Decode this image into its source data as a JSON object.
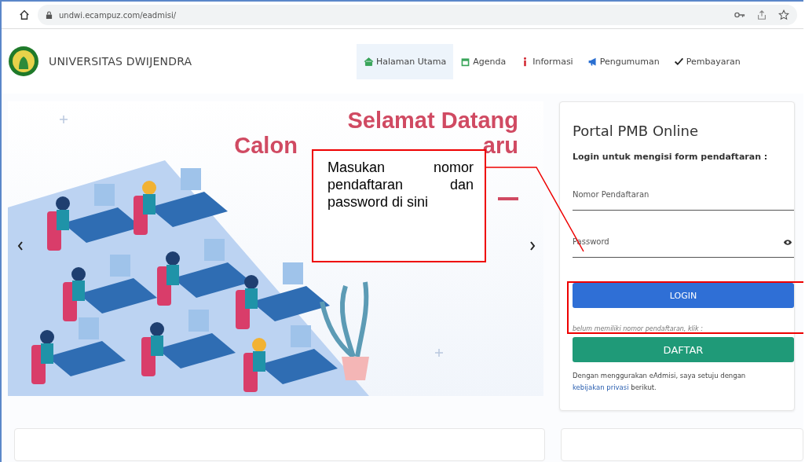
{
  "browser": {
    "url": "undwi.ecampuz.com/eadmisi/"
  },
  "header": {
    "brand": "UNIVERSITAS DWIJENDRA",
    "nav": [
      {
        "label": "Halaman Utama",
        "selected": true
      },
      {
        "label": "Agenda",
        "selected": false
      },
      {
        "label": "Informasi",
        "selected": false
      },
      {
        "label": "Pengumuman",
        "selected": false
      },
      {
        "label": "Pembayaran",
        "selected": false
      }
    ]
  },
  "hero": {
    "title_line1": "Selamat Datang",
    "title_line2_parts": [
      "Calon",
      "aru"
    ]
  },
  "login": {
    "title": "Portal PMB Online",
    "subtitle": "Login untuk mengisi form pendaftaran :",
    "fields": [
      {
        "placeholder": "Nomor Pendaftaran",
        "kind": "text"
      },
      {
        "placeholder": "Password",
        "kind": "password"
      }
    ],
    "login_button": "LOGIN",
    "register_hint": "belum memiliki nomor pendaftaran, klik :",
    "register_button": "DAFTAR",
    "terms_before": "Dengan menggurakan eAdmisi, saya setuju dengan",
    "terms_link": "kebijakan privasi",
    "terms_after": "berikut."
  },
  "annotation": {
    "text": "Masukan nomor pendaftaran dan password di sini"
  }
}
